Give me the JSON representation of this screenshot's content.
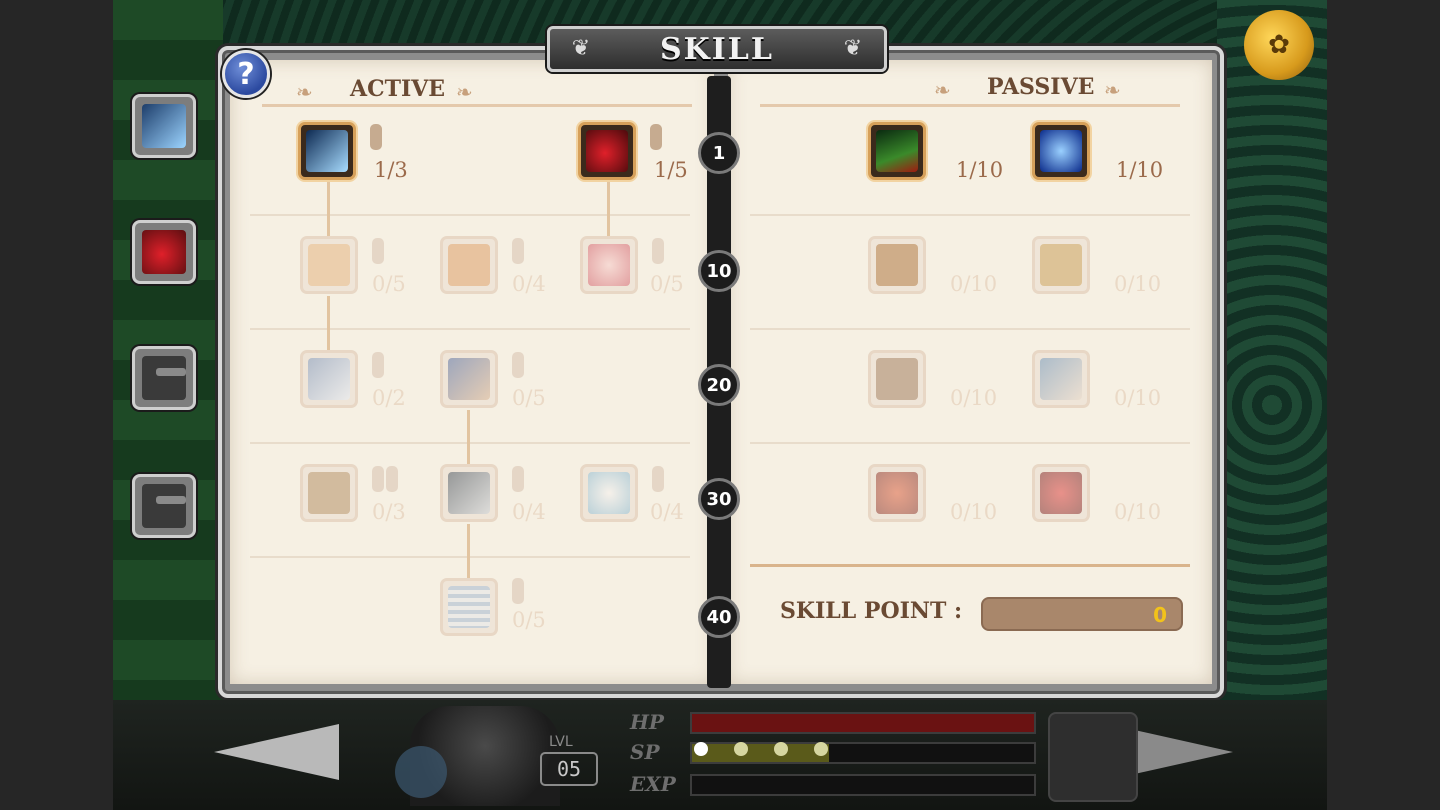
{
  "title": "SKILL",
  "help_label": "?",
  "active_header": "ACTIVE",
  "passive_header": "PASSIVE",
  "level_markers": [
    "1",
    "10",
    "20",
    "30",
    "40"
  ],
  "active_skills": {
    "row1": [
      {
        "level": "1/3",
        "icon": "wind-slash-icon"
      },
      {
        "level": "1/5",
        "icon": "red-fist-icon"
      }
    ],
    "row2": [
      {
        "level": "0/5",
        "icon": "punch-icon"
      },
      {
        "level": "0/4",
        "icon": "burst-icon"
      },
      {
        "level": "0/5",
        "icon": "pink-orb-icon"
      }
    ],
    "row3": [
      {
        "level": "0/2",
        "icon": "whirl-icon"
      },
      {
        "level": "0/5",
        "icon": "dash-icon"
      }
    ],
    "row4": [
      {
        "level": "0/3",
        "icon": "shield-icon"
      },
      {
        "level": "0/4",
        "icon": "spiral-icon"
      },
      {
        "level": "0/4",
        "icon": "frost-icon"
      }
    ],
    "row5": [
      {
        "level": "0/5",
        "icon": "scroll-icon"
      }
    ]
  },
  "passive_skills": {
    "row1": [
      {
        "level": "1/10",
        "icon": "green-claw-icon"
      },
      {
        "level": "1/10",
        "icon": "blue-spirit-icon"
      }
    ],
    "row2": [
      {
        "level": "0/10",
        "icon": "beast-icon"
      },
      {
        "level": "0/10",
        "icon": "mask-icon"
      }
    ],
    "row3": [
      {
        "level": "0/10",
        "icon": "fox-icon"
      },
      {
        "level": "0/10",
        "icon": "feather-icon"
      }
    ],
    "row4": [
      {
        "level": "0/10",
        "icon": "red-flame-icon"
      },
      {
        "level": "0/10",
        "icon": "red-heart-icon"
      }
    ]
  },
  "skill_point_label": "SKILL POINT :",
  "skill_point_value": "0",
  "hud": {
    "lvl_caption": "LVL",
    "lvl_value": "05",
    "hp_label": "HP",
    "sp_label": "SP",
    "exp_label": "EXP",
    "hp_fraction": 1.0,
    "sp_fraction": 0.4,
    "exp_fraction": 0.0
  },
  "colors": {
    "panel": "#f6f0e3",
    "header_text": "#6a4a33",
    "level_text_active": "#9b6a4b",
    "skill_point_value": "#f2c21a"
  }
}
